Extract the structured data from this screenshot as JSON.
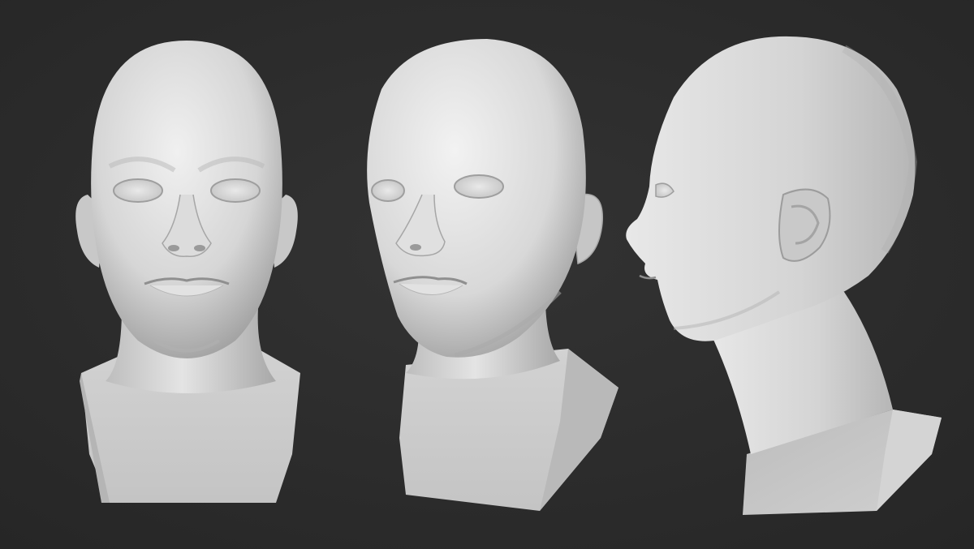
{
  "scene": {
    "background_color": "#2e2e2e",
    "clay_color": "#d9d9d9",
    "clay_shadow_color": "#8f8f8f",
    "clay_highlight_color": "#f2f2f2",
    "views": [
      {
        "name": "front",
        "icon": "head-front-view"
      },
      {
        "name": "three-quarter",
        "icon": "head-three-quarter-view"
      },
      {
        "name": "profile",
        "icon": "head-profile-view"
      }
    ]
  }
}
